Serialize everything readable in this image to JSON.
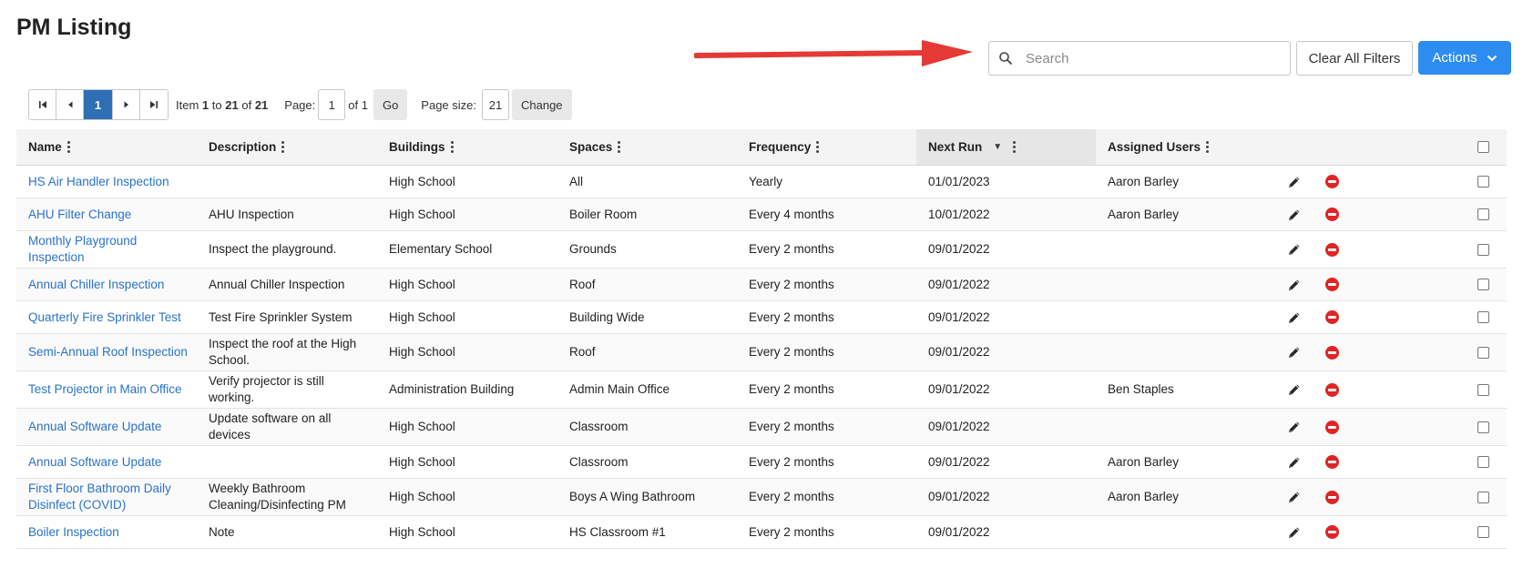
{
  "page": {
    "title": "PM Listing"
  },
  "search": {
    "placeholder": "Search",
    "value": ""
  },
  "toolbar": {
    "clear_label": "Clear All Filters",
    "actions_label": "Actions"
  },
  "pager": {
    "current_page": "1",
    "item_prefix": "Item",
    "item_from": "1",
    "item_to_word": "to",
    "item_to": "21",
    "item_of_word": "of",
    "item_total": "21",
    "page_label": "Page:",
    "page_value": "1",
    "page_of": "of 1",
    "go_label": "Go",
    "size_label": "Page size:",
    "size_value": "21",
    "change_label": "Change"
  },
  "table": {
    "columns": {
      "name": "Name",
      "description": "Description",
      "buildings": "Buildings",
      "spaces": "Spaces",
      "frequency": "Frequency",
      "next_run": "Next Run",
      "assigned_users": "Assigned Users"
    },
    "sort": {
      "column": "next_run",
      "direction": "descending"
    },
    "rows": [
      {
        "name": "HS Air Handler Inspection",
        "description": "",
        "building": "High School",
        "space": "All",
        "frequency": "Yearly",
        "next_run": "01/01/2023",
        "users": "Aaron Barley"
      },
      {
        "name": "AHU Filter Change",
        "description": "AHU Inspection",
        "building": "High School",
        "space": "Boiler Room",
        "frequency": "Every 4 months",
        "next_run": "10/01/2022",
        "users": "Aaron Barley"
      },
      {
        "name": "Monthly Playground Inspection",
        "description": "Inspect the playground.",
        "building": "Elementary School",
        "space": "Grounds",
        "frequency": "Every 2 months",
        "next_run": "09/01/2022",
        "users": ""
      },
      {
        "name": "Annual Chiller Inspection",
        "description": "Annual Chiller Inspection",
        "building": "High School",
        "space": "Roof",
        "frequency": "Every 2 months",
        "next_run": "09/01/2022",
        "users": ""
      },
      {
        "name": "Quarterly Fire Sprinkler Test",
        "description": "Test Fire Sprinkler System",
        "building": "High School",
        "space": "Building Wide",
        "frequency": "Every 2 months",
        "next_run": "09/01/2022",
        "users": ""
      },
      {
        "name": "Semi-Annual Roof Inspection",
        "description": "Inspect the roof at the High School.",
        "building": "High School",
        "space": "Roof",
        "frequency": "Every 2 months",
        "next_run": "09/01/2022",
        "users": ""
      },
      {
        "name": "Test Projector in Main Office",
        "description": "Verify projector is still working.",
        "building": "Administration Building",
        "space": "Admin Main Office",
        "frequency": "Every 2 months",
        "next_run": "09/01/2022",
        "users": "Ben Staples"
      },
      {
        "name": "Annual Software Update",
        "description": "Update software on all devices",
        "building": "High School",
        "space": "Classroom",
        "frequency": "Every 2 months",
        "next_run": "09/01/2022",
        "users": ""
      },
      {
        "name": "Annual Software Update",
        "description": "",
        "building": "High School",
        "space": "Classroom",
        "frequency": "Every 2 months",
        "next_run": "09/01/2022",
        "users": "Aaron Barley"
      },
      {
        "name": "First Floor Bathroom Daily Disinfect (COVID)",
        "description": "Weekly Bathroom Cleaning/Disinfecting PM",
        "building": "High School",
        "space": "Boys A Wing Bathroom",
        "frequency": "Every 2 months",
        "next_run": "09/01/2022",
        "users": "Aaron Barley"
      },
      {
        "name": "Boiler Inspection",
        "description": "Note",
        "building": "High School",
        "space": "HS Classroom #1",
        "frequency": "Every 2 months",
        "next_run": "09/01/2022",
        "users": ""
      }
    ]
  },
  "colors": {
    "link": "#2a72c8",
    "accent": "#2d8cf0",
    "page_active": "#2f6fb5",
    "delete": "#e02424",
    "annotation_arrow": "#e53935"
  },
  "icons": [
    "search-icon",
    "chevron-down-icon",
    "first-page-icon",
    "prev-page-icon",
    "next-page-icon",
    "last-page-icon",
    "column-menu-icon",
    "sort-desc-icon",
    "pencil-icon",
    "delete-icon",
    "annotation-arrow"
  ]
}
